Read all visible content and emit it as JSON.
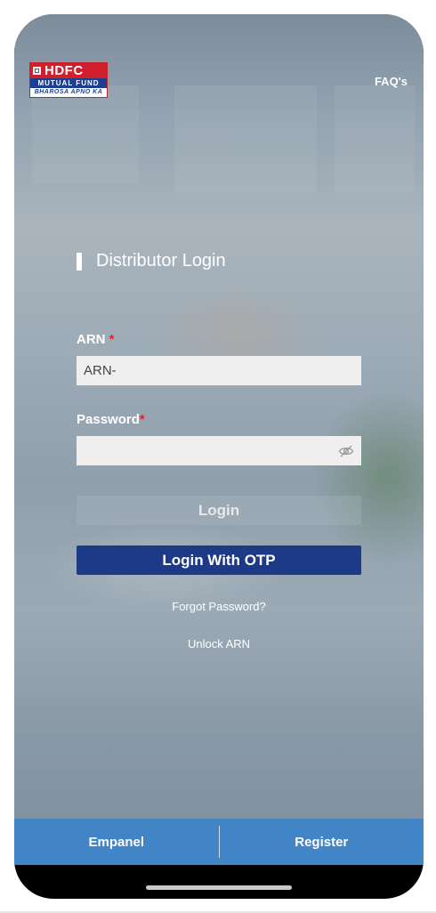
{
  "brand": {
    "logo_name": "HDFC",
    "logo_sub": "MUTUAL FUND",
    "logo_tagline": "BHAROSA APNO KA"
  },
  "header": {
    "faq_label": "FAQ's"
  },
  "login": {
    "title": "Distributor Login",
    "arn_label": "ARN",
    "arn_value": "ARN-",
    "password_label": "Password",
    "required_mark": "*",
    "login_label": "Login",
    "otp_label": "Login With OTP",
    "forgot_label": "Forgot Password?",
    "unlock_label": "Unlock ARN"
  },
  "bottom_nav": {
    "left_label": "Empanel",
    "right_label": "Register"
  },
  "icons": {
    "password_toggle": "eye-slash-icon"
  },
  "colors": {
    "primary": "#1c3a86",
    "bottom_bar": "#4285c6",
    "required": "#e0262c"
  }
}
